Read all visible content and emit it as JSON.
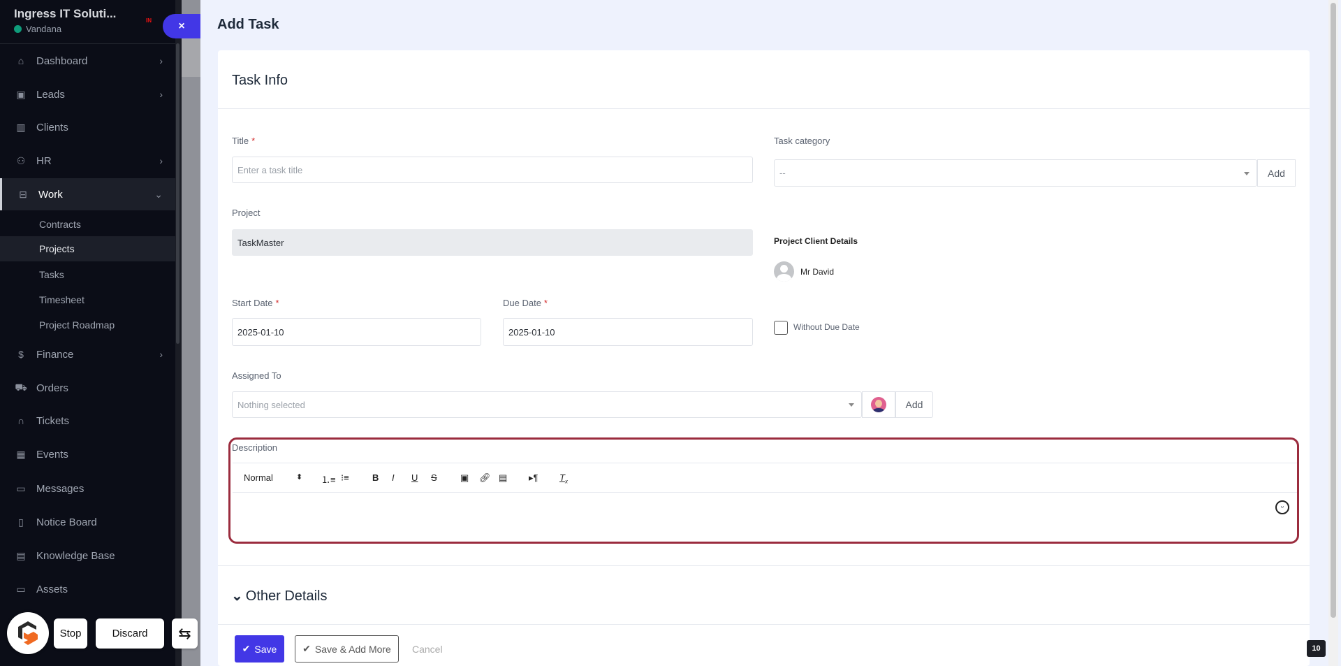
{
  "sidebar": {
    "company": "Ingress IT Soluti...",
    "user": "Vandana",
    "badge": "IN",
    "items": [
      {
        "label": "Dashboard",
        "icon": "home-icon",
        "chev": "›"
      },
      {
        "label": "Leads",
        "icon": "id-card-icon",
        "chev": "›"
      },
      {
        "label": "Clients",
        "icon": "building-icon"
      },
      {
        "label": "HR",
        "icon": "people-icon",
        "chev": "›"
      },
      {
        "label": "Work",
        "icon": "briefcase-icon",
        "chev": "⌄"
      },
      {
        "label": "Finance",
        "icon": "dollar-icon",
        "chev": "›"
      },
      {
        "label": "Orders",
        "icon": "cart-icon"
      },
      {
        "label": "Tickets",
        "icon": "headset-icon"
      },
      {
        "label": "Events",
        "icon": "calendar-icon"
      },
      {
        "label": "Messages",
        "icon": "message-icon"
      },
      {
        "label": "Notice Board",
        "icon": "clipboard-icon"
      },
      {
        "label": "Knowledge Base",
        "icon": "document-icon"
      },
      {
        "label": "Assets",
        "icon": "monitor-icon"
      }
    ],
    "work_sub": [
      "Contracts",
      "Projects",
      "Tasks",
      "Timesheet",
      "Project Roadmap"
    ],
    "close": "×"
  },
  "page": {
    "title": "Add Task",
    "section": "Task Info"
  },
  "form": {
    "title_label": "Title",
    "required": "*",
    "title_placeholder": "Enter a task title",
    "category_label": "Task category",
    "category_value": "--",
    "add": "Add",
    "project_label": "Project",
    "project_value": "TaskMaster",
    "client_heading": "Project Client Details",
    "client_name": "Mr David",
    "start_label": "Start Date",
    "start_value": "2025-01-10",
    "due_label": "Due Date",
    "due_value": "2025-01-10",
    "without_due": "Without Due Date",
    "assigned_label": "Assigned To",
    "assigned_placeholder": "Nothing selected",
    "description_label": "Description",
    "format_value": "Normal",
    "other_details": "Other Details"
  },
  "actions": {
    "save": "Save",
    "save_more": "Save & Add More",
    "cancel": "Cancel"
  },
  "overlay": {
    "stop": "Stop",
    "discard": "Discard",
    "swap": "⇆",
    "counter": "10"
  },
  "colors": {
    "primary": "#4237e6",
    "highlight_border": "#9b2c3e",
    "sidebar_bg": "#0b0d17"
  }
}
